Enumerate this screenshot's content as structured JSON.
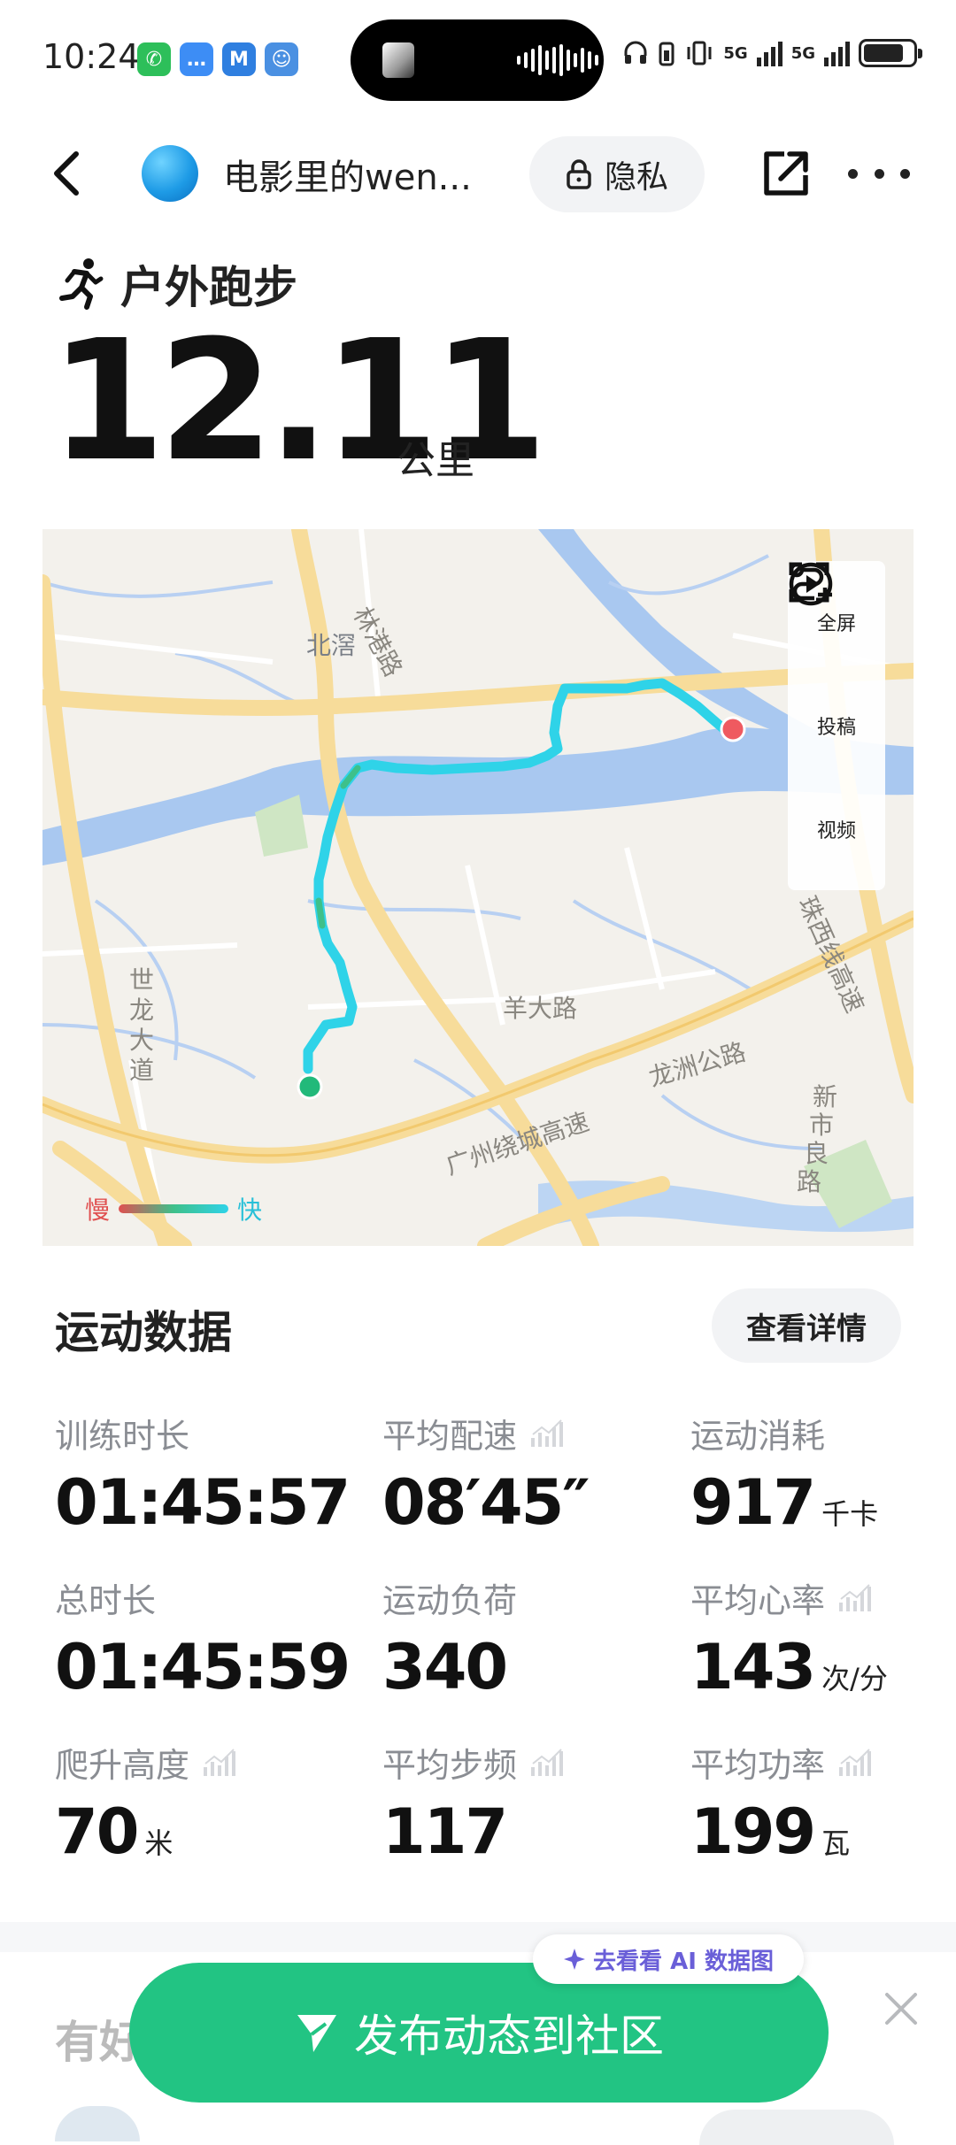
{
  "status_bar": {
    "time": "10:24",
    "network_1": "5G",
    "network_2": "5G",
    "notif_apps": [
      "wechat-icon",
      "message-icon",
      "maps-icon",
      "badge-icon"
    ]
  },
  "header": {
    "username": "电影里的wen...",
    "privacy_label": "隐私"
  },
  "activity": {
    "type": "户外跑步",
    "distance": "12.11",
    "distance_unit": "公里"
  },
  "map": {
    "labels": {
      "beijiao": "北滘",
      "linggang": "林港路",
      "shilong_1": "世",
      "shilong_2": "龙",
      "shilong_3": "大",
      "shilong_4": "道",
      "yangda": "羊大路",
      "guangzhou_ring": "广州绕城高速",
      "longzhou": "龙洲公路",
      "xinshi_1": "新",
      "xinshi_2": "市",
      "xinshi_3": "良",
      "xinshi_4": "路",
      "zhuxi": "珠西线高速"
    },
    "tools": {
      "fullscreen": "全屏",
      "post": "投稿",
      "video": "视频"
    },
    "legend": {
      "slow": "慢",
      "fast": "快"
    }
  },
  "stats_section": {
    "title": "运动数据",
    "detail_button": "查看详情",
    "items": [
      {
        "label": "训练时长",
        "value": "01:45:57",
        "unit": ""
      },
      {
        "label": "平均配速",
        "value": "08′45″",
        "unit": ""
      },
      {
        "label": "运动消耗",
        "value": "917",
        "unit": "千卡"
      },
      {
        "label": "总时长",
        "value": "01:45:59",
        "unit": ""
      },
      {
        "label": "运动负荷",
        "value": "340",
        "unit": ""
      },
      {
        "label": "平均心率",
        "value": "143",
        "unit": "次/分"
      },
      {
        "label": "爬升高度",
        "value": "70",
        "unit": "米"
      },
      {
        "label": "平均步频",
        "value": "117",
        "unit": ""
      },
      {
        "label": "平均功率",
        "value": "199",
        "unit": "瓦"
      }
    ]
  },
  "bottom": {
    "next_section_title": "有好",
    "ai_chip": "去看看 AI 数据图",
    "publish_button": "发布动态到社区"
  },
  "colors": {
    "accent_green": "#22c483",
    "route_cyan": "#2fd3e8",
    "water_blue": "#a9c8f0",
    "road_yellow": "#f7dc9a",
    "end_marker": "#ef5a60",
    "start_marker": "#22b97a"
  }
}
